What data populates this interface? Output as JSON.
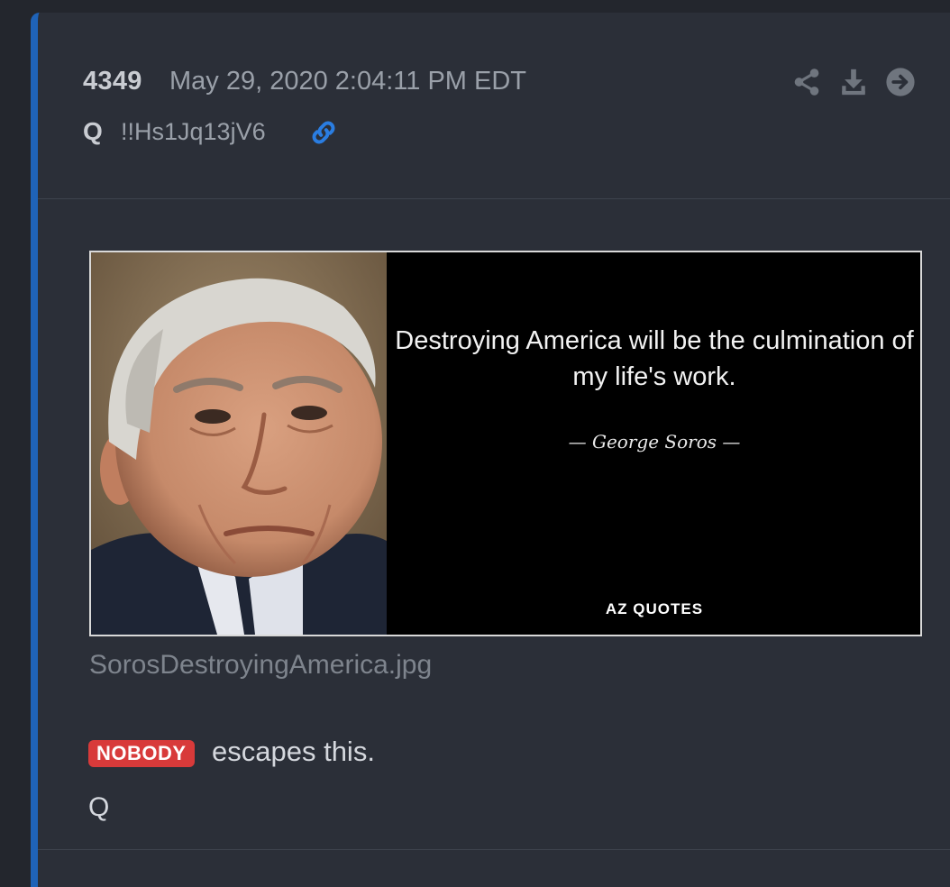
{
  "post": {
    "number": "4349",
    "timestamp": "May 29, 2020 2:04:11 PM EDT",
    "author": "Q",
    "tripcode": "!!Hs1Jq13jV6",
    "permalink_icon": "link-icon",
    "actions": [
      {
        "name": "share",
        "icon": "share-icon"
      },
      {
        "name": "download",
        "icon": "download-icon"
      },
      {
        "name": "goto",
        "icon": "arrow-right-circle-icon"
      }
    ]
  },
  "attachment": {
    "filename": "SorosDestroyingAmerica.jpg",
    "quote": "Destroying America will be the culmination of my life's work.",
    "quote_author": "— George Soros —",
    "source": "AZ QUOTES"
  },
  "message": {
    "highlight": "NOBODY",
    "text": "escapes this.",
    "signature": "Q"
  },
  "colors": {
    "background": "#23262d",
    "card": "#2b2f38",
    "accent_border": "#1f63b8",
    "link": "#2a7de1",
    "badge": "#d83a3a"
  }
}
